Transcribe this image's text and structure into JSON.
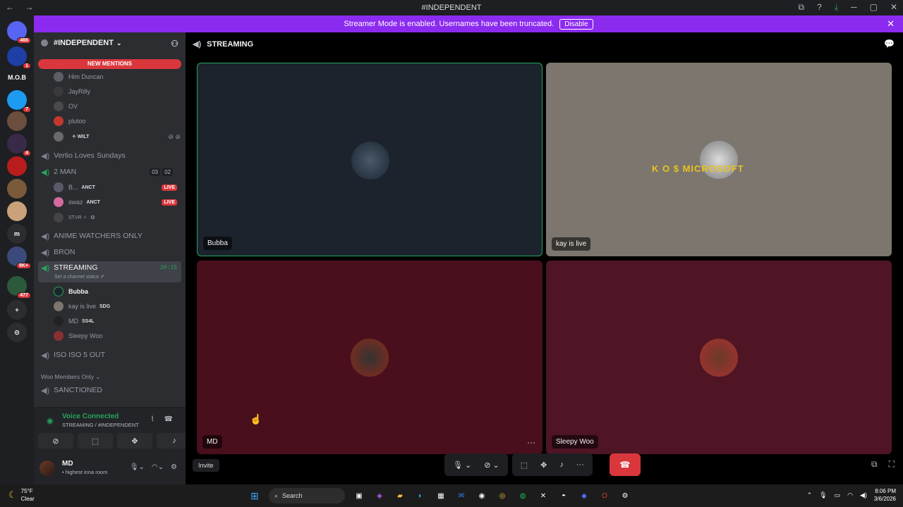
{
  "window": {
    "title": "#INDEPENDENT",
    "nav": "← →"
  },
  "banner": {
    "text": "Streamer Mode is enabled. Usernames have been truncated.",
    "disable": "Disable"
  },
  "guilds": [
    {
      "label": "",
      "badge": "466",
      "color": "#5865f2"
    },
    {
      "label": "",
      "badge": "1",
      "color": "#1d3fa6"
    },
    {
      "label": "M.O.B",
      "badge": "",
      "color": "#1e1f22"
    },
    {
      "label": "",
      "badge": "7",
      "color": "#1d9bf0"
    },
    {
      "label": "",
      "badge": "",
      "color": "#6b4e3d"
    },
    {
      "label": "",
      "badge": "4",
      "color": "#3a2a4a"
    },
    {
      "label": "",
      "badge": "",
      "color": "#b91c1c"
    },
    {
      "label": "",
      "badge": "",
      "color": "#7a5a3a"
    },
    {
      "label": "",
      "badge": "",
      "color": "#c9a27a"
    },
    {
      "label": "m",
      "badge": "",
      "color": "#2b2d31"
    },
    {
      "label": "",
      "badge": "9K+",
      "color": "#3a4a7a"
    },
    {
      "label": "",
      "badge": "477",
      "color": "#2a5a3a"
    },
    {
      "label": "+",
      "badge": "",
      "color": "#2b2d31"
    },
    {
      "label": "⊙",
      "badge": "",
      "color": "#2b2d31"
    }
  ],
  "server": {
    "name": "#INDEPENDENT",
    "new_mentions": "NEW MENTIONS"
  },
  "channels": {
    "top_users": [
      "Him Duncan",
      "JayRilly",
      "OV",
      "plutoo"
    ],
    "wilt": "✧ WILT",
    "vertio": "Vertio Loves Sundays",
    "two_man": "2 MAN",
    "two_man_count_a": "03",
    "two_man_count_b": "02",
    "two_man_users": [
      {
        "name": "B...",
        "tag": "ANCT",
        "live": "LIVE"
      },
      {
        "name": "swaz",
        "tag": "ANCT",
        "live": "LIVE"
      },
      {
        "name": "STVR ✧",
        "tag": "",
        "live": ""
      }
    ],
    "anime": "ANIME WATCHERS ONLY",
    "bron": "BRON",
    "streaming": "STREAMING",
    "streaming_time": "20:15",
    "streaming_status": "Set a channel status ✐",
    "streaming_users": [
      {
        "name": "Bubba",
        "tag": ""
      },
      {
        "name": "kay is live",
        "tag": "SDG"
      },
      {
        "name": "MD",
        "tag": "SS4L"
      },
      {
        "name": "Sleepy Woo",
        "tag": ""
      }
    ],
    "iso": "ISO ISO 5 OUT",
    "woo_category": "Woo Members Only ⌄",
    "sanctioned": "SANCTIONED"
  },
  "voice": {
    "status": "Voice Connected",
    "location": "STREAMING / #INDEPENDENT"
  },
  "user": {
    "name": "MD",
    "status": "• highest inna room"
  },
  "stage": {
    "channel": "STREAMING",
    "tiles": [
      {
        "name": "Bubba",
        "bg": "#1c232c"
      },
      {
        "name": "kay is live",
        "bg": "#7c766e"
      },
      {
        "name": "MD",
        "bg": "#4a0f1c"
      },
      {
        "name": "Sleepy Woo",
        "bg": "#4f1524"
      }
    ],
    "ko_text": "K O $ MICROSOFT",
    "invite": "Invite"
  },
  "taskbar": {
    "temp": "75°F",
    "weather": "Clear",
    "search": "Search",
    "time": "8:06 PM",
    "date": "3/6/2026"
  },
  "colors": {
    "accent": "#5865f2",
    "banner": "#8c2bf0",
    "online": "#23a55a",
    "danger": "#da373c"
  }
}
